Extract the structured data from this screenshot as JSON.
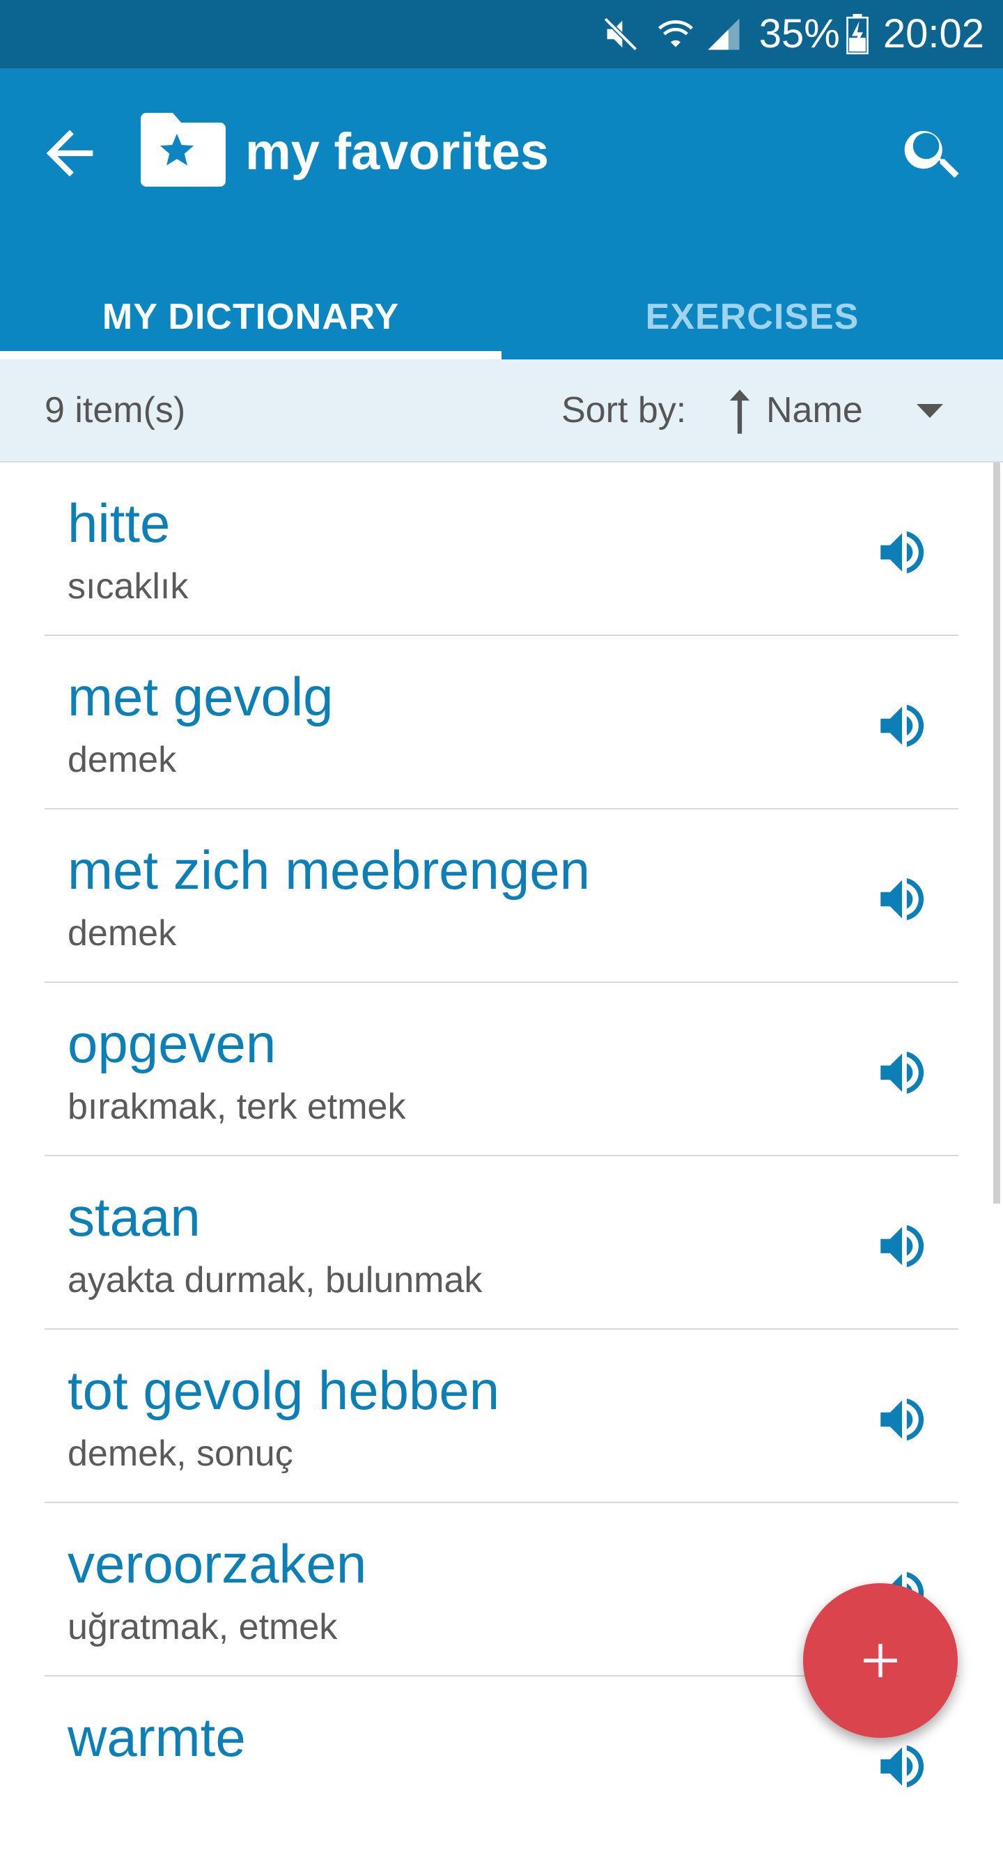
{
  "status_bar": {
    "battery": "35%",
    "time": "20:02",
    "icons": [
      "mute-icon",
      "wifi-icon",
      "signal-icon",
      "battery-charging-icon"
    ]
  },
  "app_bar": {
    "title": "my favorites",
    "back_icon": "arrow-left-icon",
    "folder_icon": "folder-star-icon",
    "search_icon": "search-icon"
  },
  "tabs": [
    {
      "label": "MY DICTIONARY",
      "selected": true
    },
    {
      "label": "EXERCISES",
      "selected": false
    }
  ],
  "sort_bar": {
    "count": "9 item(s)",
    "sort_label": "Sort by:",
    "sort_value": "Name",
    "sort_direction_icon": "arrow-up-icon",
    "dropdown_icon": "caret-down-icon"
  },
  "items": [
    {
      "term": "hitte",
      "translation": "sıcaklık"
    },
    {
      "term": "met gevolg",
      "translation": "demek"
    },
    {
      "term": "met zich meebrengen",
      "translation": "demek"
    },
    {
      "term": "opgeven",
      "translation": "bırakmak, terk etmek"
    },
    {
      "term": "staan",
      "translation": "ayakta durmak, bulunmak"
    },
    {
      "term": "tot gevolg hebben",
      "translation": "demek, sonuç"
    },
    {
      "term": "veroorzaken",
      "translation": "uğratmak, etmek"
    },
    {
      "term": "warmte",
      "translation": ""
    }
  ],
  "fab": {
    "icon": "plus-icon"
  },
  "colors": {
    "status_bar": "#0c6591",
    "app_bar": "#0c86c0",
    "accent_text": "#0c7fb6",
    "sort_bar": "#e6f1f7",
    "fab": "#d9444d"
  }
}
